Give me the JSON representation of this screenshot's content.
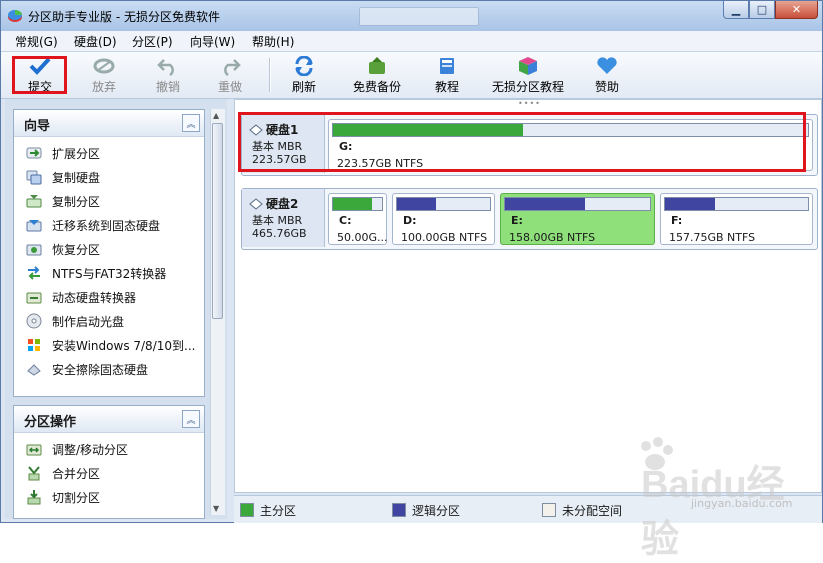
{
  "window": {
    "title": "分区助手专业版 - 无损分区免费软件"
  },
  "menu": [
    "常规(G)",
    "硬盘(D)",
    "分区(P)",
    "向导(W)",
    "帮助(H)"
  ],
  "toolbar": {
    "commit": "提交",
    "discard": "放弃",
    "undo": "撤销",
    "redo": "重做",
    "refresh": "刷新",
    "backup": "免费备份",
    "tutorial": "教程",
    "lossless_tutorial": "无损分区教程",
    "sponsor": "赞助"
  },
  "wizard_panel": {
    "title": "向导",
    "items": [
      "扩展分区",
      "复制硬盘",
      "复制分区",
      "迁移系统到固态硬盘",
      "恢复分区",
      "NTFS与FAT32转换器",
      "动态硬盘转换器",
      "制作启动光盘",
      "安装Windows 7/8/10到...",
      "安全擦除固态硬盘"
    ]
  },
  "partition_panel": {
    "title": "分区操作",
    "items": [
      "调整/移动分区",
      "合并分区",
      "切割分区"
    ]
  },
  "disks": [
    {
      "name": "硬盘1",
      "type": "基本 MBR",
      "size": "223.57GB",
      "partitions": [
        {
          "letter": "G:",
          "text": "223.57GB NTFS",
          "used": 0.4
        }
      ]
    },
    {
      "name": "硬盘2",
      "type": "基本 MBR",
      "size": "465.76GB",
      "partitions": [
        {
          "letter": "C:",
          "text": "50.00G...",
          "used": 0.8
        },
        {
          "letter": "D:",
          "text": "100.00GB NTFS",
          "used": 0.42
        },
        {
          "letter": "E:",
          "text": "158.00GB NTFS",
          "used": 0.55
        },
        {
          "letter": "F:",
          "text": "157.75GB NTFS",
          "used": 0.35
        }
      ]
    }
  ],
  "legend": {
    "primary": "主分区",
    "logical": "逻辑分区",
    "unallocated": "未分配空间"
  },
  "colors": {
    "primary": "#3aa83a",
    "logical": "#3f45a0",
    "selected": "#8fe07a",
    "highlight": "#e0141c"
  },
  "watermark": {
    "text": "Baidu经验",
    "sub": "jingyan.baidu.com"
  }
}
